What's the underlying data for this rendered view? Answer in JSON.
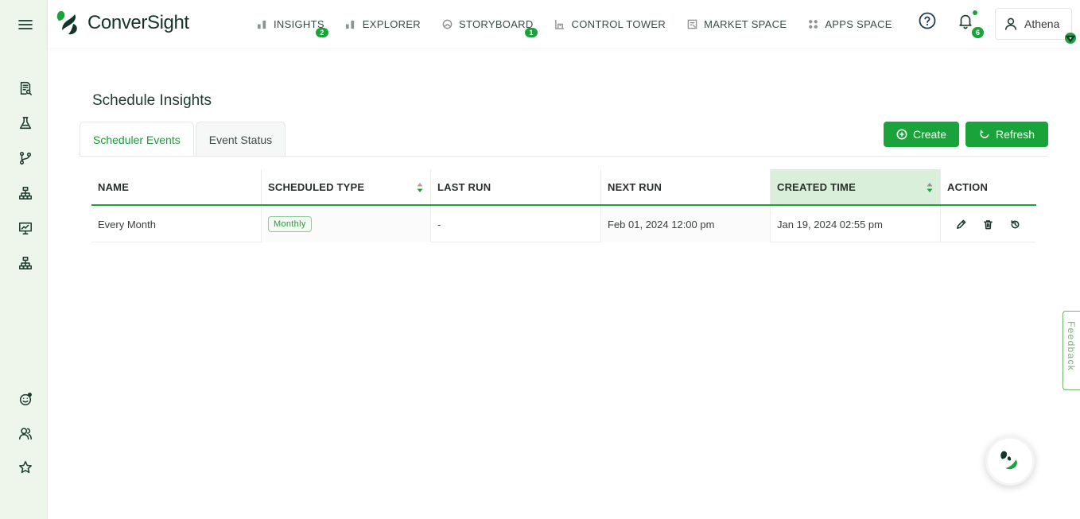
{
  "app": {
    "logo_text": "ConverSight",
    "brand_color": "#1aa33a",
    "dark_color": "#12352a"
  },
  "sidebar": {
    "items": [
      {
        "name": "menu",
        "icon": "hamburger-icon"
      },
      {
        "name": "reports",
        "icon": "report-search-icon"
      },
      {
        "name": "lab",
        "icon": "flask-icon"
      },
      {
        "name": "workflow",
        "icon": "git-branch-icon"
      },
      {
        "name": "hierarchy",
        "icon": "hierarchy-icon"
      },
      {
        "name": "presentation",
        "icon": "presentation-chart-icon"
      },
      {
        "name": "organization",
        "icon": "hierarchy-icon"
      },
      {
        "name": "assistant",
        "icon": "smiley-icon"
      },
      {
        "name": "users",
        "icon": "users-icon"
      },
      {
        "name": "favorites",
        "icon": "star-icon"
      }
    ]
  },
  "nav": {
    "items": [
      {
        "label": "INSIGHTS",
        "badge": "2",
        "icon": "bar-chart-icon"
      },
      {
        "label": "EXPLORER",
        "badge": "",
        "icon": "bar-chart-icon"
      },
      {
        "label": "STORYBOARD",
        "badge": "1",
        "icon": "pie-chart-icon"
      },
      {
        "label": "CONTROL TOWER",
        "badge": "",
        "icon": "tower-icon"
      },
      {
        "label": "MARKET SPACE",
        "badge": "",
        "icon": "market-icon"
      },
      {
        "label": "APPS SPACE",
        "badge": "",
        "icon": "apps-grid-icon"
      }
    ]
  },
  "header": {
    "notifications_count": "6",
    "user_name": "Athena"
  },
  "page": {
    "title": "Schedule Insights",
    "tabs": [
      {
        "label": "Scheduler Events",
        "active": true
      },
      {
        "label": "Event Status",
        "active": false
      }
    ],
    "create_label": "Create",
    "refresh_label": "Refresh"
  },
  "table": {
    "columns": [
      {
        "label": "NAME",
        "sortable": false
      },
      {
        "label": "SCHEDULED TYPE",
        "sortable": true
      },
      {
        "label": "LAST RUN",
        "sortable": false
      },
      {
        "label": "NEXT RUN",
        "sortable": false
      },
      {
        "label": "CREATED TIME",
        "sortable": true,
        "sorted": true
      },
      {
        "label": "ACTION",
        "sortable": false
      }
    ],
    "rows": [
      {
        "name": "Every Month",
        "scheduled_type": "Monthly",
        "last_run": "-",
        "next_run": "Feb 01, 2024 12:00 pm",
        "created_time": "Jan 19, 2024 02:55 pm",
        "actions": [
          "edit-icon",
          "trash-icon",
          "history-icon"
        ]
      }
    ]
  },
  "feedback_label": "Feedback"
}
